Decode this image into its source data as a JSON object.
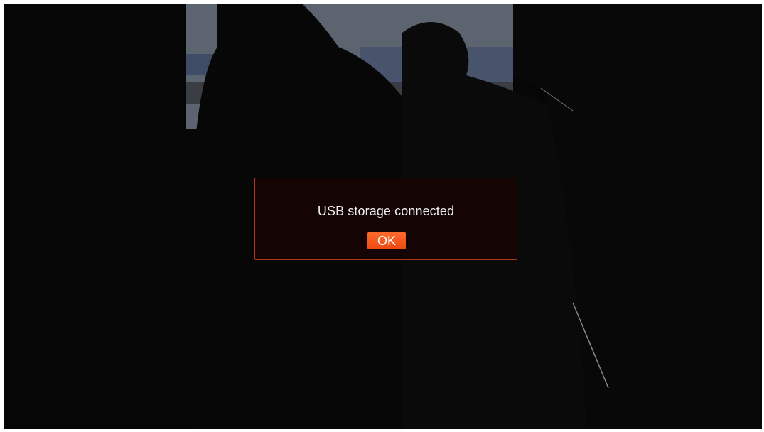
{
  "dialog": {
    "message": "USB storage connected",
    "ok_label": "OK"
  },
  "colors": {
    "dialog_border": "#b3361c",
    "dialog_background": "#160404",
    "button": "#f2541b",
    "text": "#eeeeee"
  }
}
